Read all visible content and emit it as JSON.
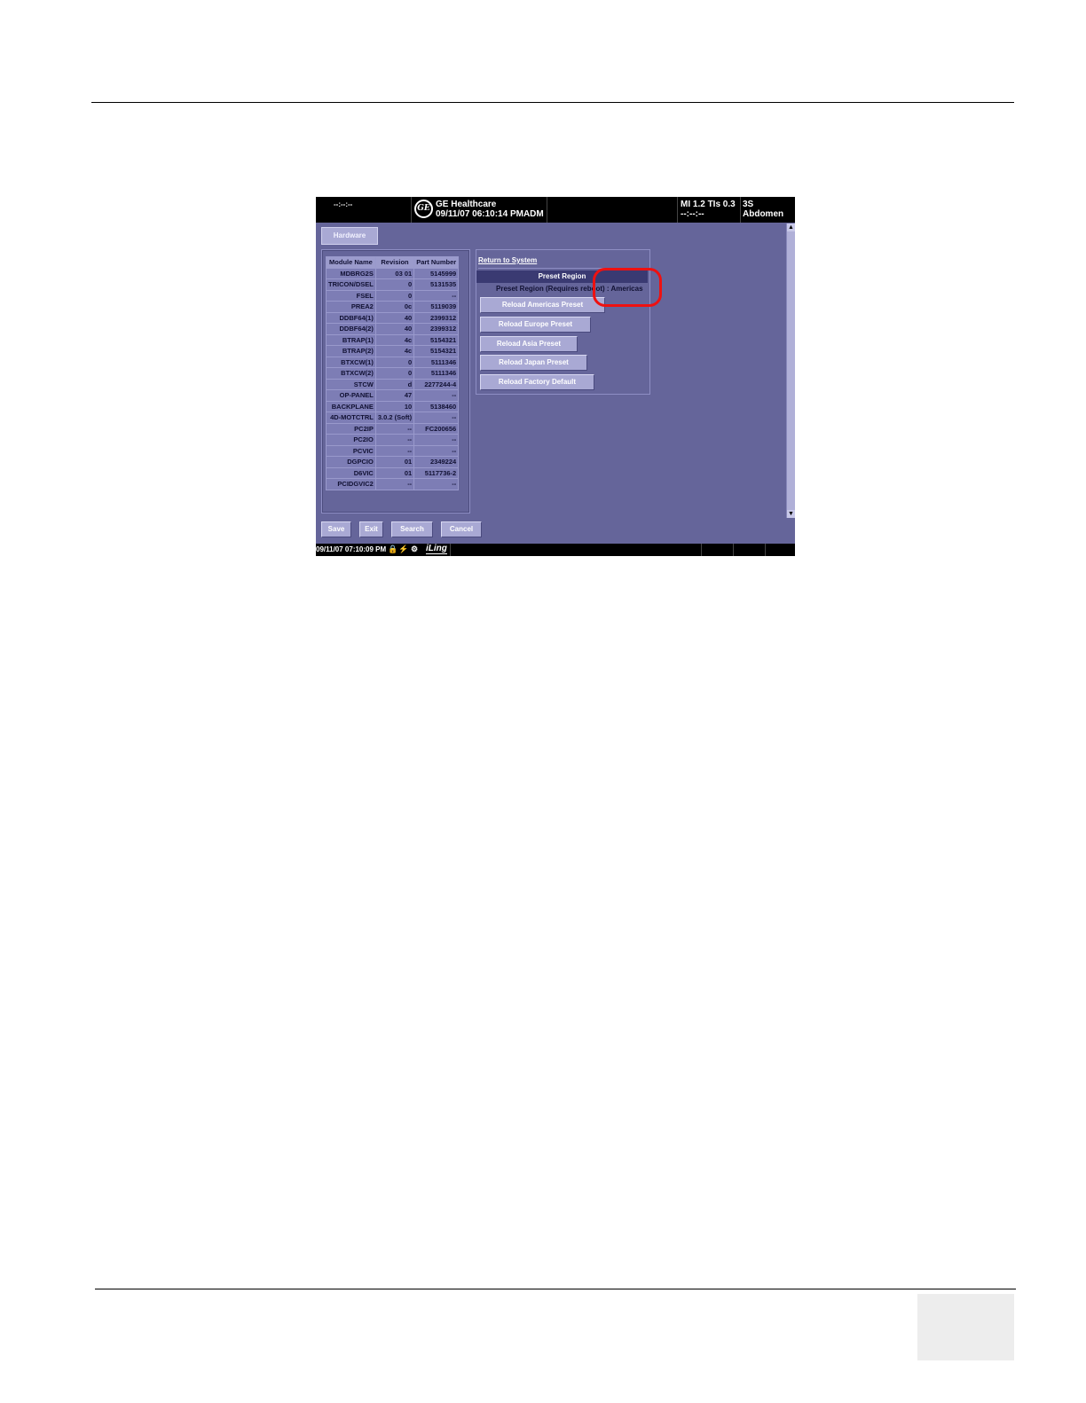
{
  "header": {
    "left_placeholder": "--:--:--",
    "logo_text": "GE",
    "brand": "GE Healthcare",
    "datetime_user": "09/11/07 06:10:14 PMADM",
    "mi_tis": "MI 1.2   TIs 0.3",
    "mi_sub": "--:--:--",
    "probe": "3S",
    "app": "Abdomen"
  },
  "tabs": {
    "hardware": "Hardware"
  },
  "module_table": {
    "headers": [
      "Module Name",
      "Revision",
      "Part Number"
    ],
    "rows": [
      [
        "MDBRG2S",
        "03 01",
        "5145999"
      ],
      [
        "TRICON/DSEL",
        "0",
        "5131535"
      ],
      [
        "FSEL",
        "0",
        "--"
      ],
      [
        "PREA2",
        "0c",
        "5119039"
      ],
      [
        "DDBF64(1)",
        "40",
        "2399312"
      ],
      [
        "DDBF64(2)",
        "40",
        "2399312"
      ],
      [
        "BTRAP(1)",
        "4c",
        "5154321"
      ],
      [
        "BTRAP(2)",
        "4c",
        "5154321"
      ],
      [
        "BTXCW(1)",
        "0",
        "5111346"
      ],
      [
        "BTXCW(2)",
        "0",
        "5111346"
      ],
      [
        "STCW",
        "d",
        "2277244-4"
      ],
      [
        "OP-PANEL",
        "47",
        "--"
      ],
      [
        "BACKPLANE",
        "10",
        "5138460"
      ],
      [
        "4D-MOTCTRL",
        "3.0.2 (Soft)",
        "--"
      ],
      [
        "PC2IP",
        "--",
        "FC200656"
      ],
      [
        "PC2IO",
        "--",
        "--"
      ],
      [
        "PCVIC",
        "--",
        "--"
      ],
      [
        "DGPCIO",
        "01",
        "2349224"
      ],
      [
        "D6VIC",
        "01",
        "5117736-2"
      ],
      [
        "PCIDGVIC2",
        "--",
        "--"
      ]
    ]
  },
  "preset": {
    "return_link": "Return to System",
    "header": "Preset Region",
    "current": "Preset Region (Requires reboot) : Americas",
    "buttons": [
      "Reload Americas Preset",
      "Reload Europe Preset",
      "Reload Asia Preset",
      "Reload Japan Preset",
      "Reload Factory Default"
    ]
  },
  "bottom_buttons": {
    "save": "Save",
    "exit": "Exit",
    "search": "Search",
    "cancel": "Cancel"
  },
  "status": {
    "time": "09/11/07 07:10:09 PM",
    "brand_mark": "iLing",
    "callout_color": "#ee1111"
  }
}
